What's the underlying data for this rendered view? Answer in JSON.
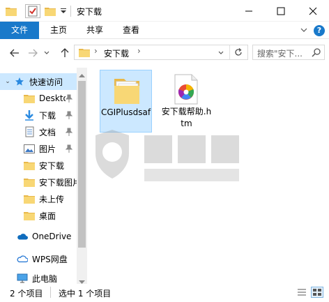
{
  "window": {
    "title": "安下载"
  },
  "ribbon": {
    "tabs": [
      "文件",
      "主页",
      "共享",
      "查看"
    ]
  },
  "address": {
    "path": [
      "安下载"
    ]
  },
  "search": {
    "placeholder": "搜索\"安下..."
  },
  "nav_pane": {
    "items": [
      {
        "label": "快速访问",
        "icon": "star-icon"
      },
      {
        "label": "Desktop",
        "icon": "folder-icon",
        "pinned": true
      },
      {
        "label": "下载",
        "icon": "download-icon",
        "pinned": true
      },
      {
        "label": "文档",
        "icon": "document-icon",
        "pinned": true
      },
      {
        "label": "图片",
        "icon": "picture-icon",
        "pinned": true
      },
      {
        "label": "安下载",
        "icon": "folder-icon"
      },
      {
        "label": "安下载图片",
        "icon": "folder-icon"
      },
      {
        "label": "未上传",
        "icon": "folder-icon"
      },
      {
        "label": "桌面",
        "icon": "folder-icon"
      },
      {
        "label": "OneDrive",
        "icon": "cloud-icon"
      },
      {
        "label": "WPS网盘",
        "icon": "wps-cloud-icon"
      },
      {
        "label": "此电脑",
        "icon": "computer-icon"
      }
    ]
  },
  "files": [
    {
      "name": "CGIPlusdsaf",
      "type": "folder",
      "selected": true
    },
    {
      "name": "安下载帮助.htm",
      "type": "htm",
      "selected": false
    }
  ],
  "status": {
    "count": "2 个项目",
    "selection": "选中 1 个项目"
  },
  "colors": {
    "accent": "#1979ca",
    "selection": "#cce8ff",
    "folder": "#f8d775"
  }
}
